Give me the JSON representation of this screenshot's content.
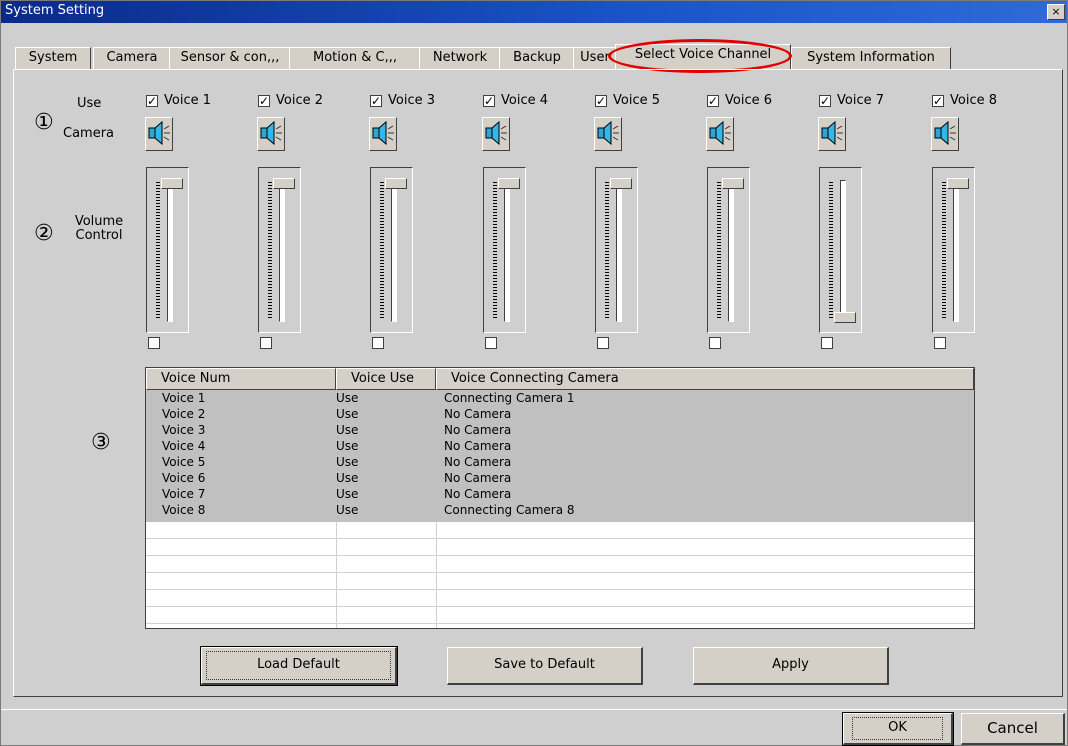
{
  "window": {
    "title": "System Setting",
    "close_glyph": "×"
  },
  "tabs": [
    {
      "label": "System"
    },
    {
      "label": "Camera"
    },
    {
      "label": "Sensor & con,,,"
    },
    {
      "label": "Motion & C,,,"
    },
    {
      "label": "Network"
    },
    {
      "label": "Backup"
    },
    {
      "label": "User"
    },
    {
      "label": "Select Voice Channel",
      "active": true
    },
    {
      "label": "System Information"
    }
  ],
  "annotation_color": "#e00000",
  "markers": {
    "m1": "①",
    "m2": "②",
    "m3": "③"
  },
  "labels": {
    "use": "Use",
    "camera": "Camera",
    "volume_line1": "Volume",
    "volume_line2": "Control"
  },
  "voices": [
    {
      "label": "Voice 1",
      "checked": true,
      "volume": 1.0,
      "muted": false
    },
    {
      "label": "Voice 2",
      "checked": true,
      "volume": 1.0,
      "muted": false
    },
    {
      "label": "Voice 3",
      "checked": true,
      "volume": 1.0,
      "muted": false
    },
    {
      "label": "Voice 4",
      "checked": true,
      "volume": 1.0,
      "muted": false
    },
    {
      "label": "Voice 5",
      "checked": true,
      "volume": 1.0,
      "muted": false
    },
    {
      "label": "Voice 6",
      "checked": true,
      "volume": 1.0,
      "muted": false
    },
    {
      "label": "Voice 7",
      "checked": true,
      "volume": 0.0,
      "muted": false
    },
    {
      "label": "Voice 8",
      "checked": true,
      "volume": 1.0,
      "muted": false
    }
  ],
  "check_glyph": "✓",
  "speaker_icon": "speaker-icon",
  "table": {
    "headers": [
      "Voice Num",
      "Voice Use",
      "Voice Connecting Camera"
    ],
    "rows": [
      [
        "Voice 1",
        "Use",
        "Connecting Camera 1"
      ],
      [
        "Voice 2",
        "Use",
        "No Camera"
      ],
      [
        "Voice 3",
        "Use",
        "No Camera"
      ],
      [
        "Voice 4",
        "Use",
        "No Camera"
      ],
      [
        "Voice 5",
        "Use",
        "No Camera"
      ],
      [
        "Voice 6",
        "Use",
        "No Camera"
      ],
      [
        "Voice 7",
        "Use",
        "No Camera"
      ],
      [
        "Voice 8",
        "Use",
        "Connecting Camera 8"
      ]
    ]
  },
  "buttons": {
    "load_default": "Load Default",
    "save_to_default": "Save to Default",
    "apply": "Apply",
    "ok": "OK",
    "cancel": "Cancel"
  }
}
